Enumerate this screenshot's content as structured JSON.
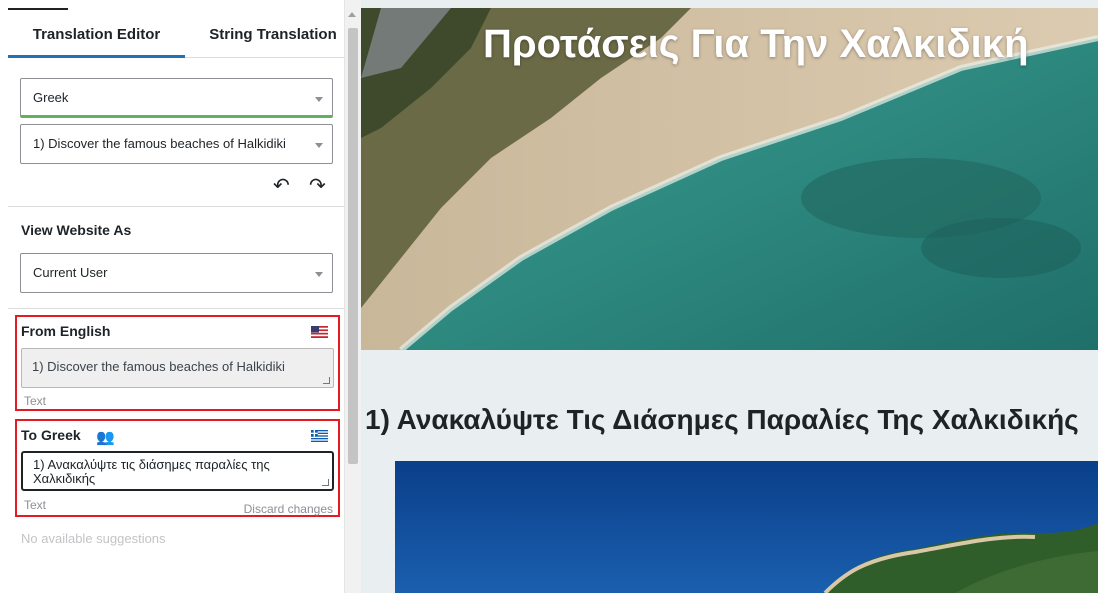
{
  "sidebar": {
    "tabs": [
      {
        "label": "Translation Editor",
        "active": true
      },
      {
        "label": "String Translation",
        "active": false
      }
    ],
    "language_select": {
      "value": "Greek"
    },
    "string_select": {
      "value": "1) Discover the famous beaches of Halkidiki"
    },
    "view_as": {
      "label": "View Website As",
      "value": "Current User"
    },
    "from": {
      "title": "From English",
      "flag": "us-flag-icon",
      "text": "1) Discover the famous beaches of Halkidiki",
      "type_label": "Text"
    },
    "to": {
      "title": "To Greek",
      "flag": "greece-flag-icon",
      "people_icon": "people-icon",
      "text": "1) Ανακαλύψτε τις διάσημες παραλίες της Χαλκιδικής",
      "type_label": "Text",
      "discard_label": "Discard changes"
    },
    "suggestions": "No available suggestions"
  },
  "preview": {
    "hero_title": "Προτάσεις Για Την Χαλκιδική",
    "subtitle": "1) Ανακαλύψτε Τις Διάσημες Παραλίες Της Χαλκιδικής"
  },
  "colors": {
    "accent": "#2271b1",
    "highlight_border": "#e31b23",
    "language_underline": "#5fb35f"
  }
}
